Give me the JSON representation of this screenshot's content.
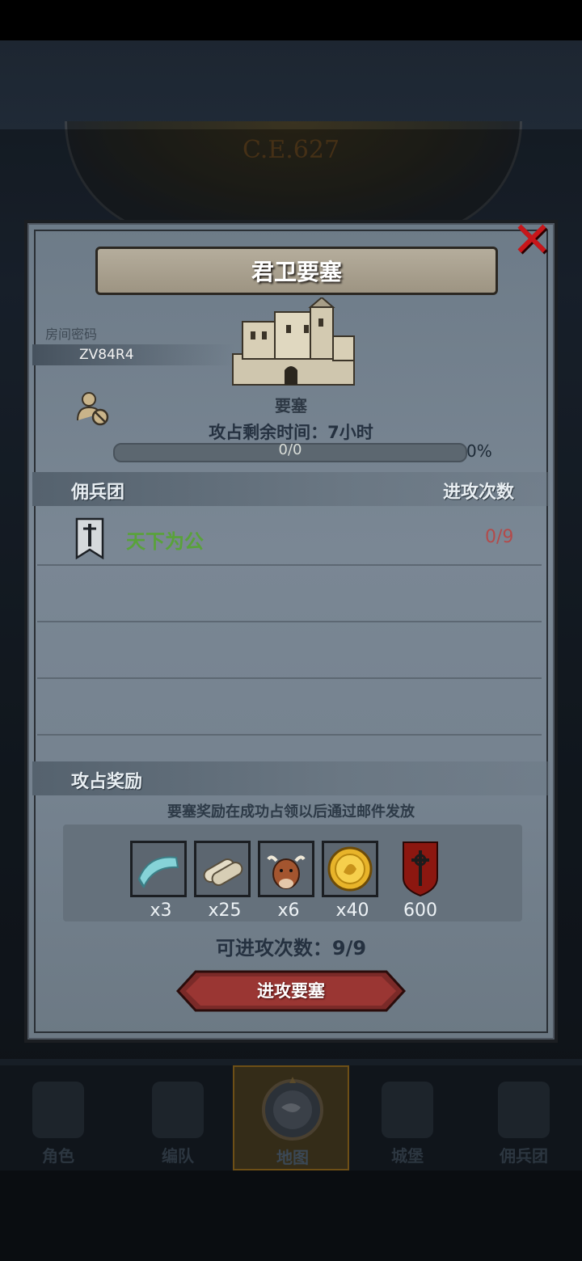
{
  "background": {
    "era": "C.E.627"
  },
  "dialog": {
    "title": "君卫要塞",
    "room_label": "房间密码",
    "room_code": "ZV84R4",
    "fortress_label": "要塞",
    "remaining_time": "攻占剩余时间：7小时",
    "progress_text": "0/0",
    "progress_percent": "0%",
    "progress_fraction": 0,
    "mercenary_header": "佣兵团",
    "attacks_header": "进攻次数",
    "guilds": [
      {
        "name": "天下为公",
        "attacks": "0/9"
      }
    ],
    "reward_header": "攻占奖励",
    "reward_note": "要塞奖励在成功占领以后通过邮件发放",
    "rewards": [
      {
        "icon": "cloth-icon",
        "qty": "x3"
      },
      {
        "icon": "scroll-icon",
        "qty": "x25"
      },
      {
        "icon": "ox-icon",
        "qty": "x6"
      },
      {
        "icon": "gold-coin-icon",
        "qty": "x40"
      },
      {
        "icon": "banner-emblem-icon",
        "qty": "600"
      }
    ],
    "attack_count": "可进攻次数：9/9",
    "attack_button": "进攻要塞"
  },
  "nav": {
    "items": [
      {
        "label": "角色",
        "icon": "knight-icon"
      },
      {
        "label": "编队",
        "icon": "helmet-icon"
      },
      {
        "label": "地图",
        "icon": "compass-map-icon",
        "active": true
      },
      {
        "label": "城堡",
        "icon": "castle-icon"
      },
      {
        "label": "佣兵团",
        "icon": "mercenary-icon"
      }
    ]
  },
  "colors": {
    "accent_red": "#c8161a",
    "guild_green": "#59a23a",
    "attack_red": "#b34a4a"
  }
}
